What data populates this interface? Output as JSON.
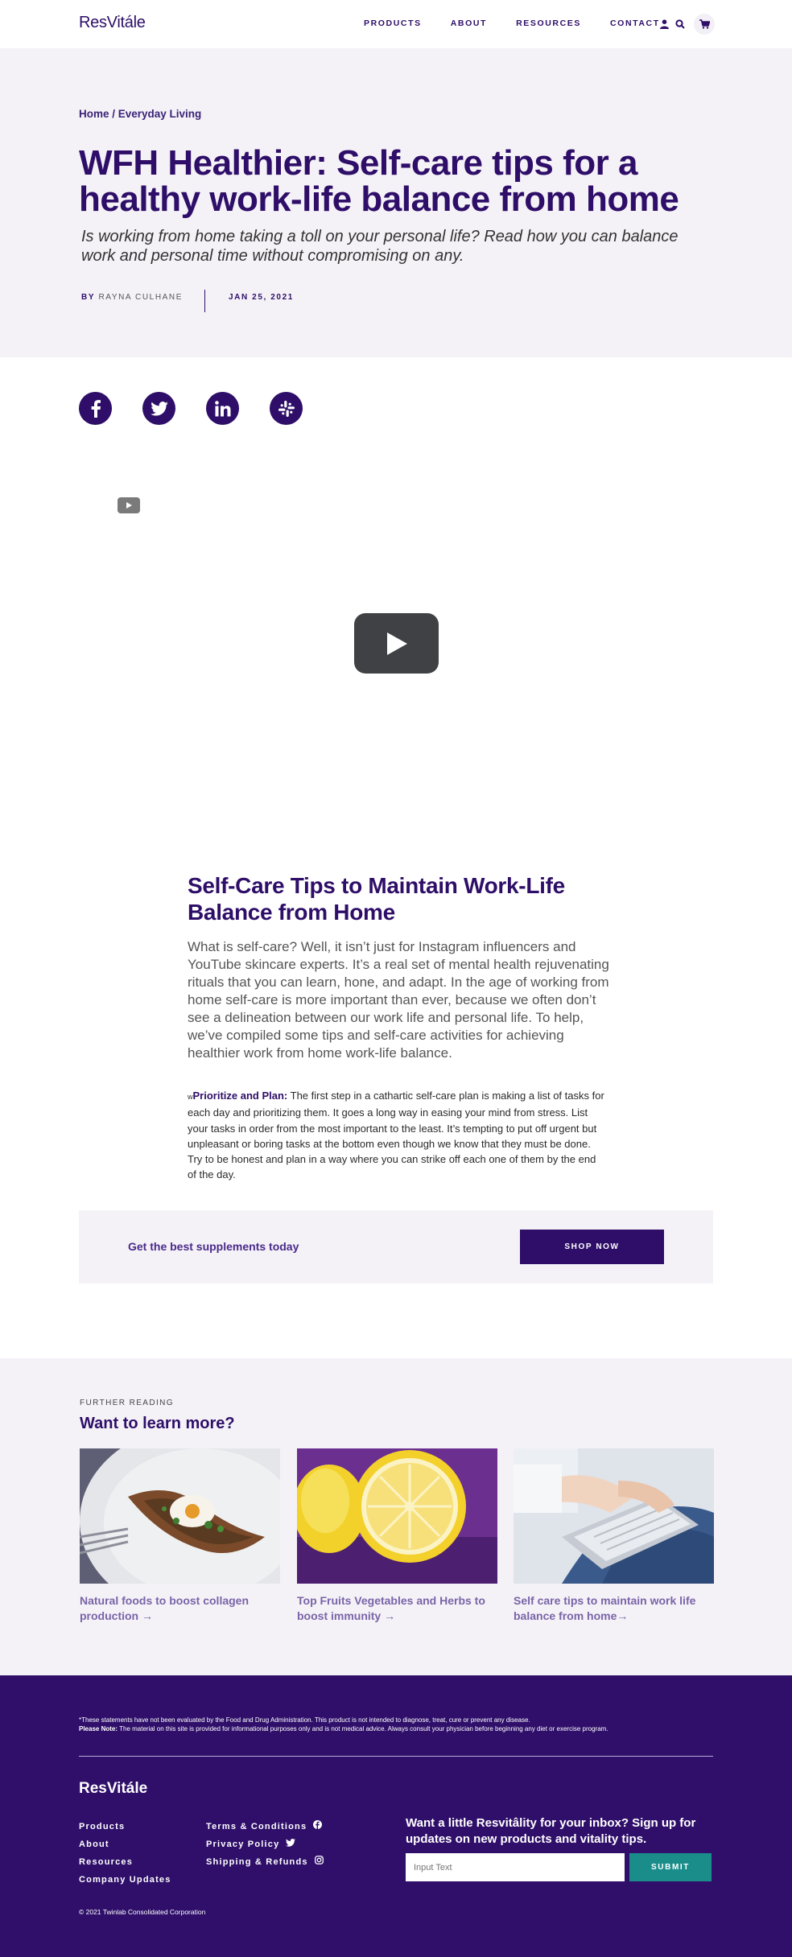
{
  "header": {
    "logo": "ResVitále",
    "nav": [
      "PRODUCTS",
      "ABOUT",
      "RESOURCES",
      "CONTACT"
    ]
  },
  "hero": {
    "breadcrumb": "Home / Everyday Living",
    "title": "WFH Healthier: Self-care tips for a healthy work-life balance from home",
    "subtitle": "Is working from home taking a toll on your personal life? Read how you can balance work and personal time without compromising on any.",
    "byline_prefix": "BY",
    "author": "RAYNA CULHANE",
    "date": "JAN 25, 2021"
  },
  "social": {
    "icons": [
      "facebook-icon",
      "twitter-icon",
      "linkedin-icon",
      "slack-icon"
    ]
  },
  "article": {
    "heading": "Self-Care Tips to Maintain Work-Life Balance from Home",
    "intro": "What is self-care? Well, it isn’t just for Instagram influencers and YouTube skincare experts. It’s a real set of mental health rejuvenating rituals that you can learn, hone, and adapt. In the age of working from home self-care is more important than ever, because we often don’t see a delineation between our work life and personal life. To help, we’ve compiled some tips and self-care activities for achieving healthier work from home work-life balance.",
    "tip_marker": "w",
    "tip_title": "Prioritize and Plan:",
    "tip_body": " The first step in a cathartic self-care plan is making a list of tasks for each day and prioritizing them. It goes a long way in easing your mind from stress. List your tasks in order from the most important to the least. It’s tempting to put off urgent but unpleasant or boring tasks at the bottom even though we know that they must be done. Try to be honest and plan in a way where you can strike off each one of them by the end of the day."
  },
  "cta": {
    "text": "Get the best supplements today",
    "button": "SHOP NOW"
  },
  "further": {
    "eyebrow": "FURTHER READING",
    "title": "Want to learn more?",
    "cards": [
      {
        "caption": "Natural foods to boost collagen production →"
      },
      {
        "caption": "Top Fruits Vegetables and Herbs to boost immunity →"
      },
      {
        "caption": "Self care tips to maintain work life balance from home→"
      }
    ]
  },
  "footer": {
    "disclaimer": "*These statements have not been evaluated by the Food and Drug Administration. This product is not intended to diagnose, treat, cure or prevent any disease.",
    "note_label": "Please Note:",
    "note_text": " The material on this site is provided for informational purposes only and is not medical advice. Always consult your physician before beginning any diet or exercise program.",
    "logo": "ResVitále",
    "col1": [
      "Products",
      "About",
      "Resources",
      "Company Updates"
    ],
    "col2": [
      "Terms & Conditions",
      "Privacy Policy",
      "Shipping & Refunds"
    ],
    "newsletter": "Want a little Resvitâlity for your inbox? Sign up for updates on new products and vitality tips.",
    "input_placeholder": "Input Text",
    "submit": "SUBMIT",
    "copyright": "© 2021 Twinlab Consolidated Corporation"
  }
}
